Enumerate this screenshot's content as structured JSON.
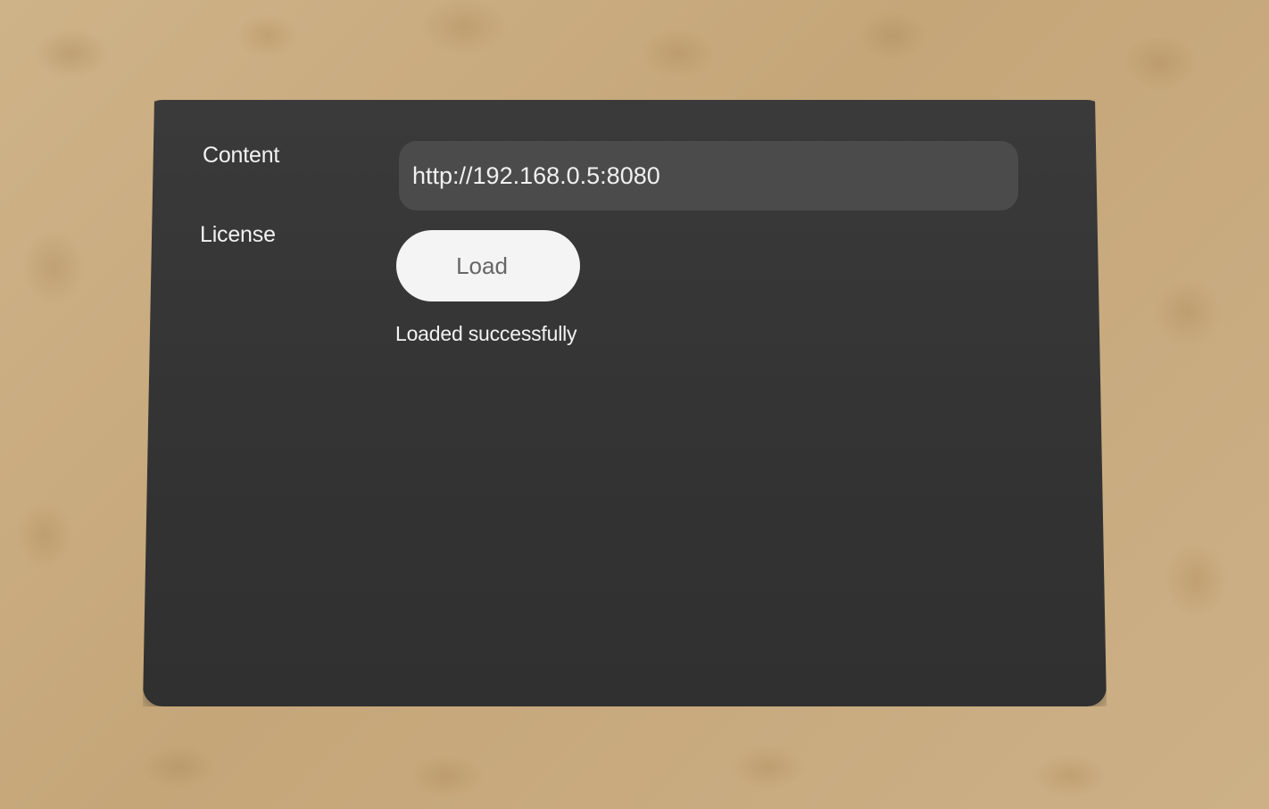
{
  "form": {
    "content_label": "Content",
    "license_label": "License",
    "content_value": "http://192.168.0.5:8080",
    "load_label": "Load",
    "status": "Loaded successfully"
  },
  "colors": {
    "panel": "#353535",
    "field": "#4b4b4b",
    "button": "#f4f4f4",
    "button_text": "#666666",
    "text": "#f2f2f2"
  }
}
